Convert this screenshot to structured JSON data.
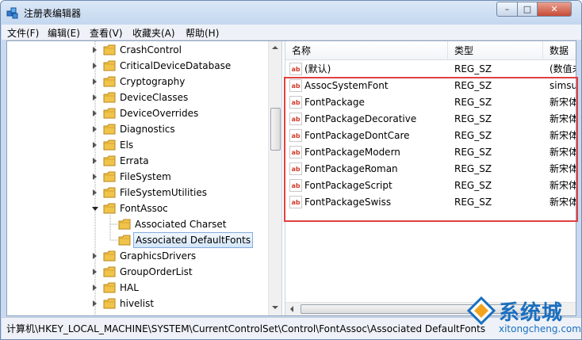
{
  "window": {
    "title": "注册表编辑器",
    "min_label": "–",
    "max_label": "□",
    "close_label": "✕"
  },
  "menu": [
    "文件(F)",
    "编辑(E)",
    "查看(V)",
    "收藏夹(A)",
    "帮助(H)"
  ],
  "tree": {
    "items": [
      {
        "label": "CrashControl",
        "expanded": false,
        "selected": false
      },
      {
        "label": "CriticalDeviceDatabase",
        "expanded": false,
        "selected": false
      },
      {
        "label": "Cryptography",
        "expanded": false,
        "selected": false
      },
      {
        "label": "DeviceClasses",
        "expanded": false,
        "selected": false
      },
      {
        "label": "DeviceOverrides",
        "expanded": false,
        "selected": false
      },
      {
        "label": "Diagnostics",
        "expanded": false,
        "selected": false
      },
      {
        "label": "Els",
        "expanded": false,
        "selected": false
      },
      {
        "label": "Errata",
        "expanded": false,
        "selected": false
      },
      {
        "label": "FileSystem",
        "expanded": false,
        "selected": false
      },
      {
        "label": "FileSystemUtilities",
        "expanded": false,
        "selected": false
      },
      {
        "label": "FontAssoc",
        "expanded": true,
        "selected": false
      },
      {
        "label": "Associated Charset",
        "expanded": false,
        "selected": false,
        "child": true
      },
      {
        "label": "Associated DefaultFonts",
        "expanded": false,
        "selected": true,
        "child": true
      },
      {
        "label": "GraphicsDrivers",
        "expanded": false,
        "selected": false
      },
      {
        "label": "GroupOrderList",
        "expanded": false,
        "selected": false
      },
      {
        "label": "HAL",
        "expanded": false,
        "selected": false
      },
      {
        "label": "hivelist",
        "expanded": false,
        "selected": false
      }
    ]
  },
  "list": {
    "columns": [
      "名称",
      "类型",
      "数据"
    ],
    "rows": [
      {
        "name": "(默认)",
        "type": "REG_SZ",
        "data": "(数值未"
      },
      {
        "name": "AssocSystemFont",
        "type": "REG_SZ",
        "data": "simsun"
      },
      {
        "name": "FontPackage",
        "type": "REG_SZ",
        "data": "新宋体"
      },
      {
        "name": "FontPackageDecorative",
        "type": "REG_SZ",
        "data": "新宋体"
      },
      {
        "name": "FontPackageDontCare",
        "type": "REG_SZ",
        "data": "新宋体"
      },
      {
        "name": "FontPackageModern",
        "type": "REG_SZ",
        "data": "新宋体"
      },
      {
        "name": "FontPackageRoman",
        "type": "REG_SZ",
        "data": "新宋体"
      },
      {
        "name": "FontPackageScript",
        "type": "REG_SZ",
        "data": "新宋体"
      },
      {
        "name": "FontPackageSwiss",
        "type": "REG_SZ",
        "data": "新宋体"
      }
    ]
  },
  "status": {
    "path": "计算机\\HKEY_LOCAL_MACHINE\\SYSTEM\\CurrentControlSet\\Control\\FontAssoc\\Associated DefaultFonts"
  },
  "watermark": {
    "brand": "系统城",
    "site": "xitongcheng.com"
  },
  "colors": {
    "highlight_box": "#e04040",
    "selection": "#d3e6fb",
    "watermark": "#1a6fc0"
  }
}
